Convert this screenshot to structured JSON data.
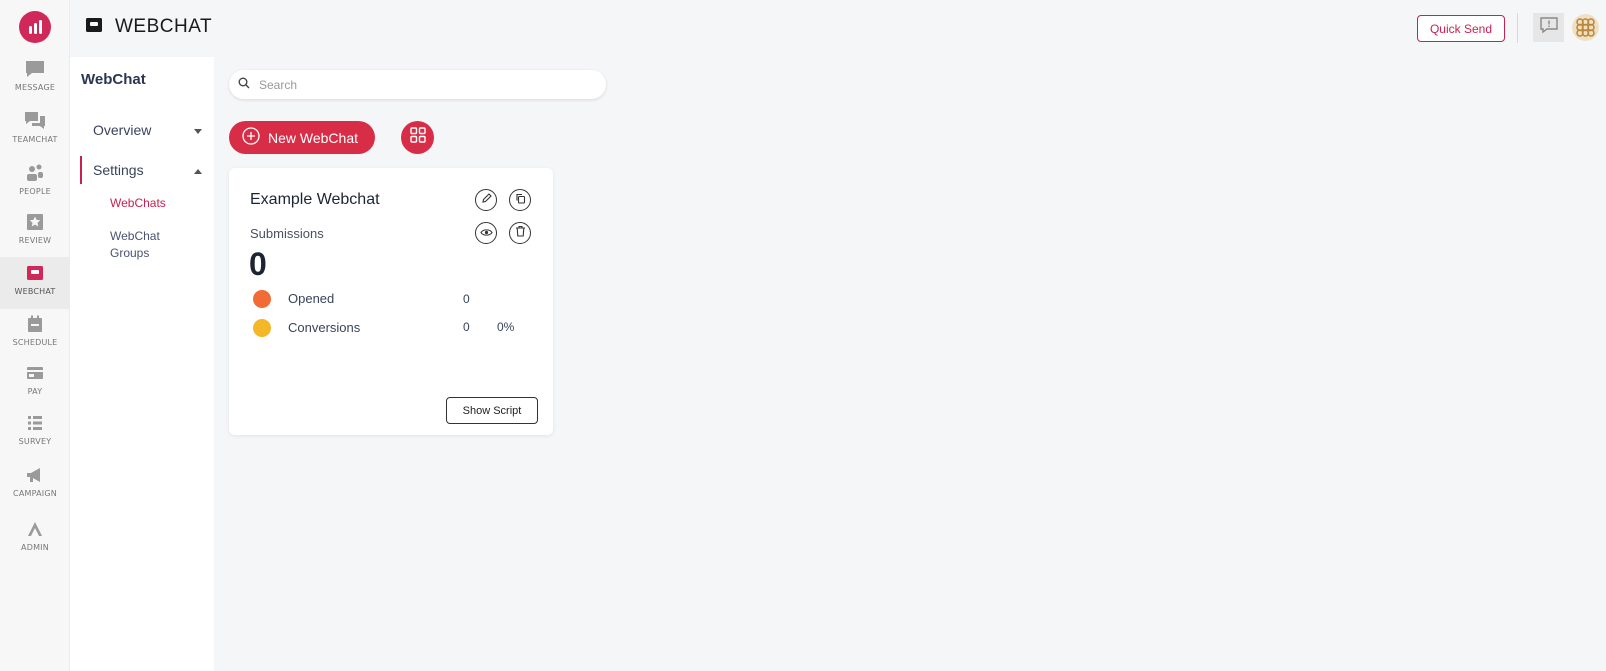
{
  "header": {
    "title": "WEBCHAT",
    "quick_send_label": "Quick Send"
  },
  "rail": {
    "items": [
      {
        "label": "MESSAGE",
        "icon": "message-icon"
      },
      {
        "label": "TEAMCHAT",
        "icon": "teamchat-icon"
      },
      {
        "label": "PEOPLE",
        "icon": "people-icon"
      },
      {
        "label": "REVIEW",
        "icon": "star-icon"
      },
      {
        "label": "WEBCHAT",
        "icon": "webchat-icon",
        "active": true
      },
      {
        "label": "SCHEDULE",
        "icon": "calendar-icon"
      },
      {
        "label": "PAY",
        "icon": "card-icon"
      },
      {
        "label": "SURVEY",
        "icon": "list-icon"
      },
      {
        "label": "CAMPAIGN",
        "icon": "megaphone-icon"
      },
      {
        "label": "ADMIN",
        "icon": "admin-icon"
      }
    ]
  },
  "subnav": {
    "title": "WebChat",
    "overview_label": "Overview",
    "settings_label": "Settings",
    "links": [
      {
        "label": "WebChats",
        "active": true
      },
      {
        "label": "WebChat Groups"
      }
    ]
  },
  "search": {
    "placeholder": "Search"
  },
  "toolbar": {
    "new_webchat_label": "New WebChat"
  },
  "card": {
    "title": "Example Webchat",
    "submissions_label": "Submissions",
    "submissions_value": "0",
    "stats": [
      {
        "label": "Opened",
        "value": "0",
        "color": "#f26a35"
      },
      {
        "label": "Conversions",
        "value": "0",
        "percent": "0%",
        "color": "#f4b728"
      }
    ],
    "show_script_label": "Show Script"
  },
  "colors": {
    "brand": "#c8214f",
    "button": "#d82d47"
  }
}
